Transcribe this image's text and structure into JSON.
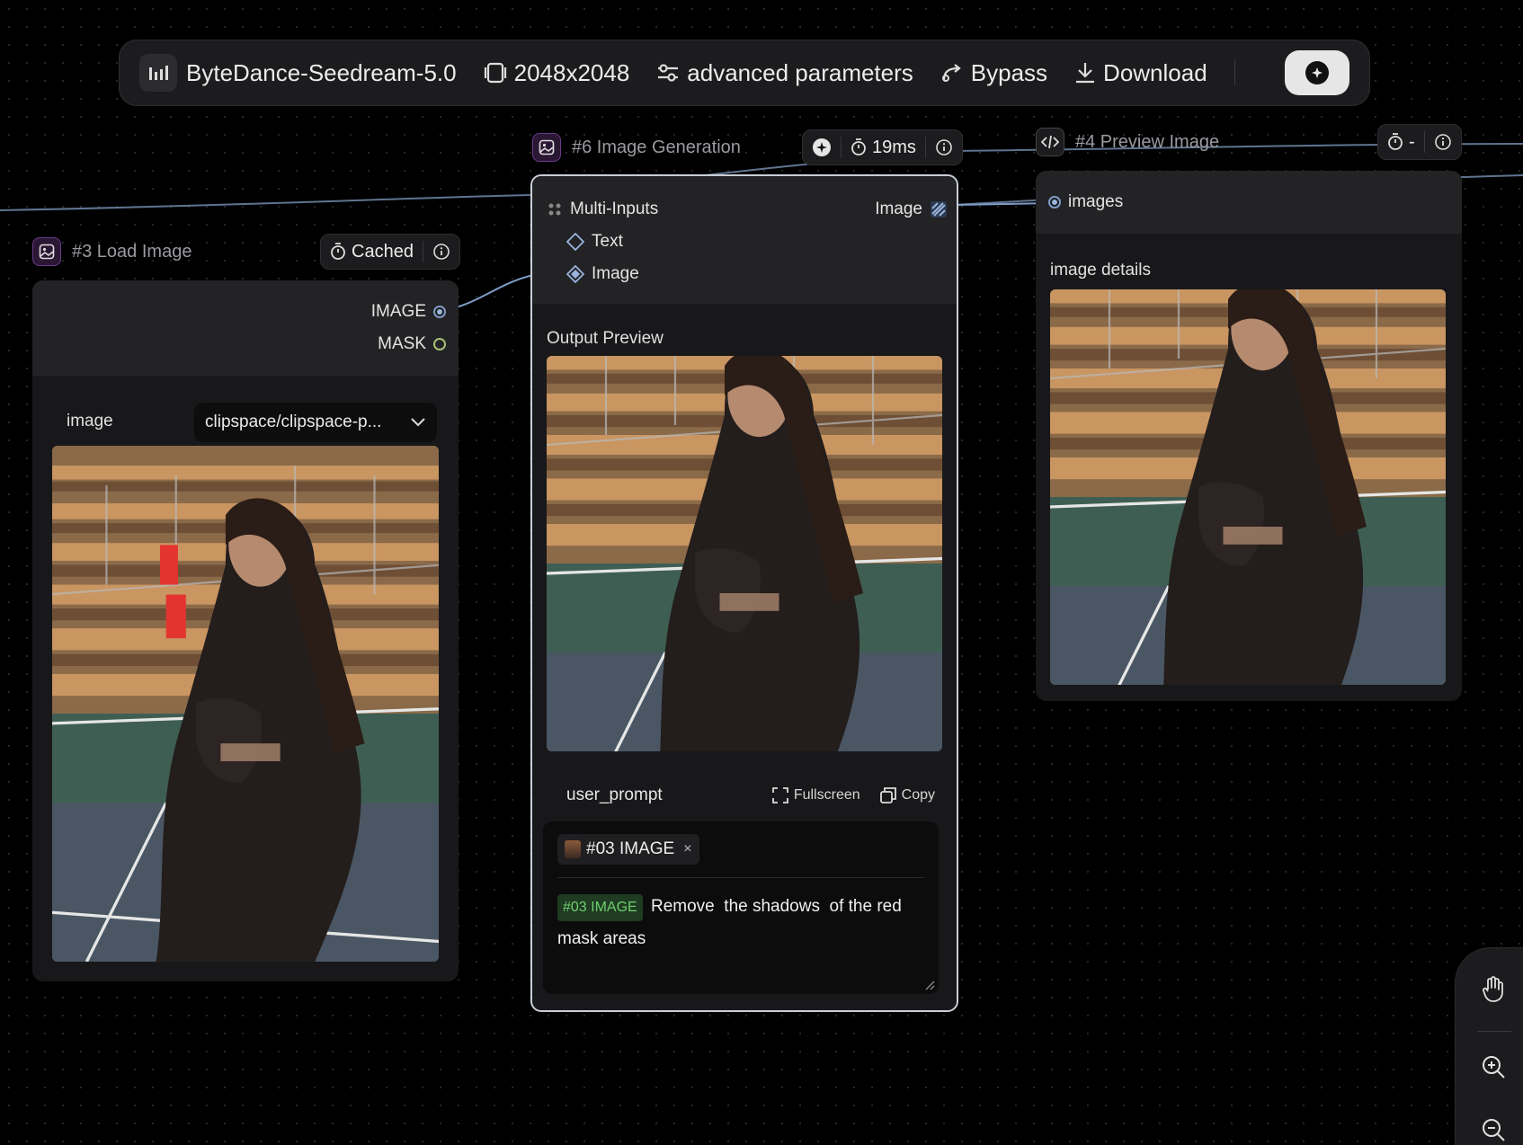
{
  "toolbar": {
    "model": "ByteDance-Seedream-5.0",
    "resolution": "2048x2048",
    "advanced": "advanced parameters",
    "bypass": "Bypass",
    "download": "Download"
  },
  "nodes": {
    "load_image": {
      "title": "#3 Load Image",
      "status": "Cached",
      "outputs": [
        "IMAGE",
        "MASK"
      ],
      "field_label": "image",
      "field_value": "clipspace/clipspace-p..."
    },
    "generation": {
      "title": "#6 Image Generation",
      "time": "19ms",
      "multi_inputs": "Multi-Inputs",
      "output_label": "Image",
      "inputs": [
        "Text",
        "Image"
      ],
      "preview_label": "Output Preview",
      "prompt_label": "user_prompt",
      "fullscreen": "Fullscreen",
      "copy": "Copy",
      "chip": "#03 IMAGE",
      "chip_close": "×",
      "prompt_tag": "#03 IMAGE",
      "prompt_text_1": "Remove  the shadows  of the red",
      "prompt_text_2": "mask areas"
    },
    "preview": {
      "title": "#4 Preview Image",
      "time": "-",
      "input": "images",
      "details_label": "image details"
    }
  },
  "icons": [
    "chart-icon",
    "frame-icon",
    "sliders-icon",
    "bypass-icon",
    "download-icon",
    "run-icon",
    "image-node-icon",
    "code-icon",
    "timer-icon",
    "info-icon",
    "hand-icon",
    "zoom-in-icon",
    "zoom-out-icon",
    "chevron-down-icon",
    "fullscreen-icon",
    "copy-icon"
  ],
  "colors": {
    "accent_port": "#7f9cc7",
    "mask_port": "#a8c07a",
    "tag_green": "#6fd06f",
    "node_icon_border": "#6b3a8a"
  }
}
